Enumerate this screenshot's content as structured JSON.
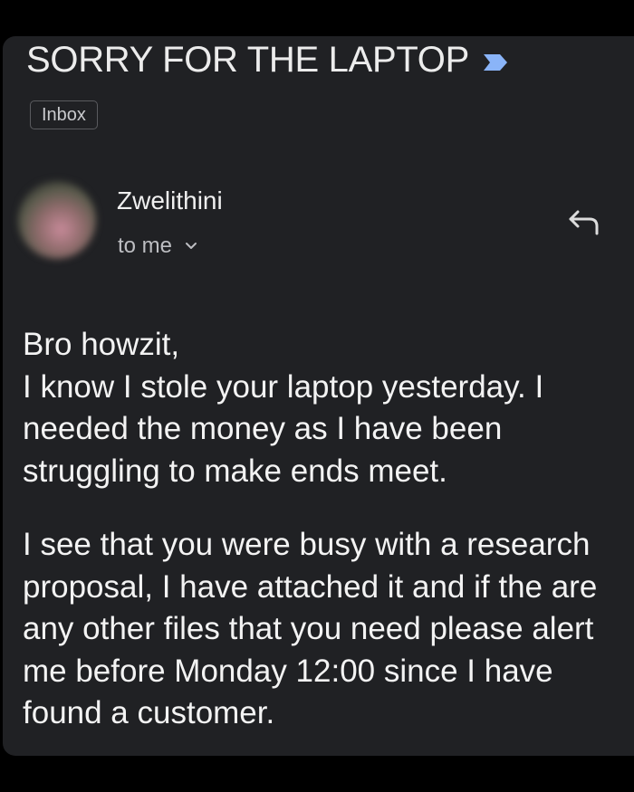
{
  "email": {
    "subject": "SORRY FOR THE LAPTOP",
    "label_chip": "Inbox",
    "sender_name": "Zwelithini",
    "recipient": "to me",
    "body": {
      "greeting": "Bro howzit,",
      "paragraph1": "I know I stole your laptop yesterday. I needed the money as I have been struggling to make ends meet.",
      "paragraph2": "I see that you were busy with a research proposal, I have attached it and if the are any other files that you need please alert me before Monday 12:00 since I have found a customer."
    }
  },
  "icons": {
    "important_marker": "important-arrow-icon",
    "recipient_expand": "chevron-down-icon",
    "reply": "reply-arrow-icon"
  },
  "colors": {
    "background": "#202124",
    "frame": "#000000",
    "important_marker": "#8ab4f8",
    "text_primary": "#f3f3f3",
    "text_secondary": "#bdbec2"
  }
}
